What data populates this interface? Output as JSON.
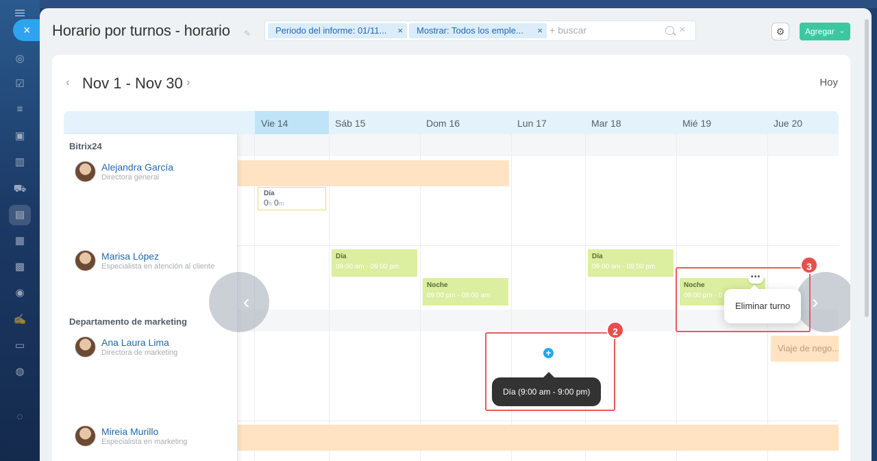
{
  "header": {
    "title": "Horario por turnos - horario",
    "filters": [
      {
        "label": "Periodo del informe: 01/11..."
      },
      {
        "label": "Mostrar: Todos los emple..."
      }
    ],
    "search_placeholder": "+ buscar",
    "add_label": "Agregar"
  },
  "nav": {
    "range": "Nov 1 - Nov 30",
    "today": "Hoy",
    "prev": "‹",
    "next": "›"
  },
  "columns": [
    {
      "label": "Vie 14",
      "today": true
    },
    {
      "label": "Sáb 15"
    },
    {
      "label": "Dom 16"
    },
    {
      "label": "Lun 17"
    },
    {
      "label": "Mar 18"
    },
    {
      "label": "Mié 19"
    },
    {
      "label": "Jue 20"
    }
  ],
  "departments": [
    {
      "name": "Bitrix24"
    },
    {
      "name": "Departamento de marketing"
    }
  ],
  "people": [
    {
      "name": "Alejandra García",
      "title": "Directora general"
    },
    {
      "name": "Marisa López",
      "title": "Especialista en atención al cliente"
    },
    {
      "name": "Ana Laura Lima",
      "title": "Directora de marketing"
    },
    {
      "name": "Mireia Murillo",
      "title": "Especialista en marketing"
    }
  ],
  "shifts": {
    "alejandra_day": {
      "name": "Día",
      "hours": "0",
      "h": "h",
      "minutes": "0",
      "m": "m"
    },
    "marisa_sat": {
      "name": "Día",
      "time": "09:00 am - 09:00 pm"
    },
    "marisa_sun": {
      "name": "Noche",
      "time": "09:00 pm - 09:00 am"
    },
    "marisa_tue": {
      "name": "Día",
      "time": "09:00 am - 09:00 pm"
    },
    "marisa_wed": {
      "name": "Noche",
      "time": "09:00 pm - 0"
    }
  },
  "absence_ana": "Viaje de nego...",
  "tooltip_add": "Día (9:00 am - 9:00 pm)",
  "popup_delete": "Eliminar turno",
  "badges": {
    "two": "2",
    "three": "3"
  },
  "icons": {
    "close": "×",
    "pin": "✎",
    "chip_remove": "×",
    "clear": "×",
    "gear": "⚙",
    "chevron": "⌄",
    "plus": "+",
    "more": "•••",
    "arrow_left": "‹",
    "arrow_right": "›"
  }
}
